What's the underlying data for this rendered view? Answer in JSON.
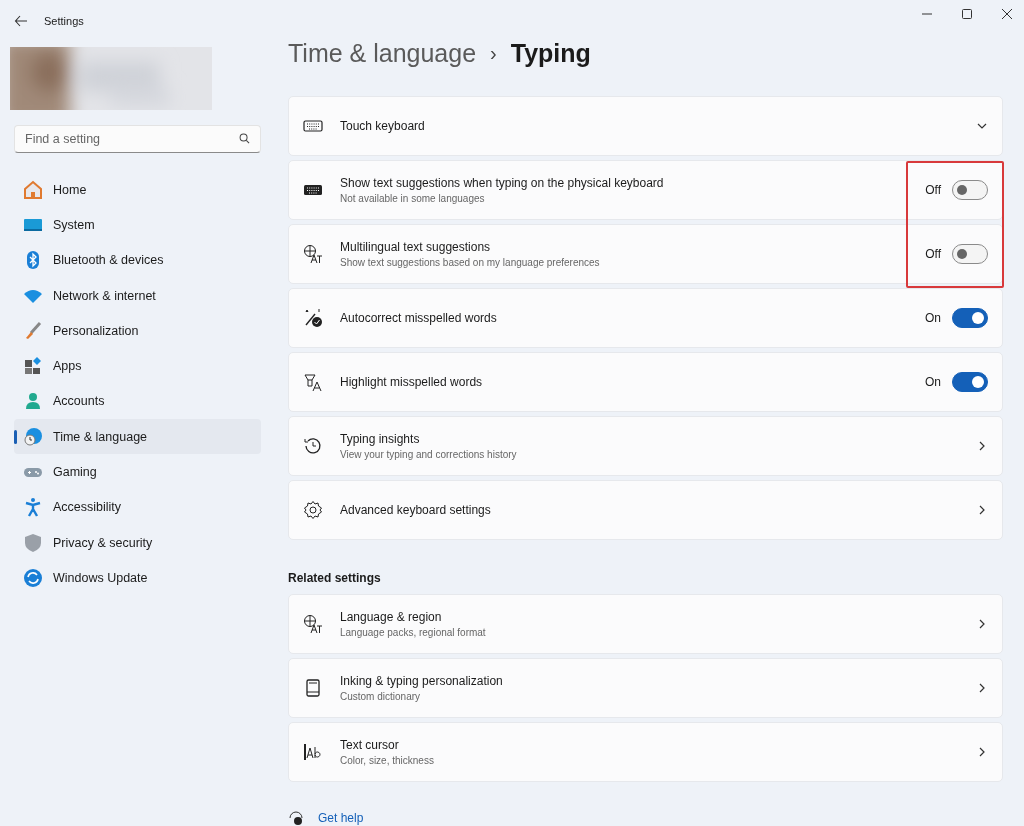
{
  "window": {
    "title": "Settings"
  },
  "search": {
    "placeholder": "Find a setting"
  },
  "sidebar": {
    "items": [
      {
        "label": "Home",
        "selected": false
      },
      {
        "label": "System",
        "selected": false
      },
      {
        "label": "Bluetooth & devices",
        "selected": false
      },
      {
        "label": "Network & internet",
        "selected": false
      },
      {
        "label": "Personalization",
        "selected": false
      },
      {
        "label": "Apps",
        "selected": false
      },
      {
        "label": "Accounts",
        "selected": false
      },
      {
        "label": "Time & language",
        "selected": true
      },
      {
        "label": "Gaming",
        "selected": false
      },
      {
        "label": "Accessibility",
        "selected": false
      },
      {
        "label": "Privacy & security",
        "selected": false
      },
      {
        "label": "Windows Update",
        "selected": false
      }
    ]
  },
  "breadcrumb": {
    "parent": "Time & language",
    "separator": "›",
    "current": "Typing"
  },
  "settings": [
    {
      "kind": "expander",
      "label": "Touch keyboard",
      "highlighted": false
    },
    {
      "kind": "toggle",
      "label": "Show text suggestions when typing on the physical keyboard",
      "description": "Not available in some languages",
      "state_label": "Off",
      "on": false,
      "highlighted": true
    },
    {
      "kind": "toggle",
      "label": "Multilingual text suggestions",
      "description": "Show text suggestions based on my language preferences",
      "state_label": "Off",
      "on": false,
      "highlighted": true
    },
    {
      "kind": "toggle",
      "label": "Autocorrect misspelled words",
      "state_label": "On",
      "on": true,
      "highlighted": false
    },
    {
      "kind": "toggle",
      "label": "Highlight misspelled words",
      "state_label": "On",
      "on": true,
      "highlighted": false
    },
    {
      "kind": "link",
      "label": "Typing insights",
      "description": "View your typing and corrections history",
      "highlighted": false
    },
    {
      "kind": "link",
      "label": "Advanced keyboard settings",
      "highlighted": false
    }
  ],
  "related": {
    "heading": "Related settings",
    "items": [
      {
        "kind": "link",
        "label": "Language & region",
        "description": "Language packs, regional format"
      },
      {
        "kind": "link",
        "label": "Inking & typing personalization",
        "description": "Custom dictionary"
      },
      {
        "kind": "link",
        "label": "Text cursor",
        "description": "Color, size, thickness"
      }
    ]
  },
  "help": {
    "label": "Get help"
  }
}
